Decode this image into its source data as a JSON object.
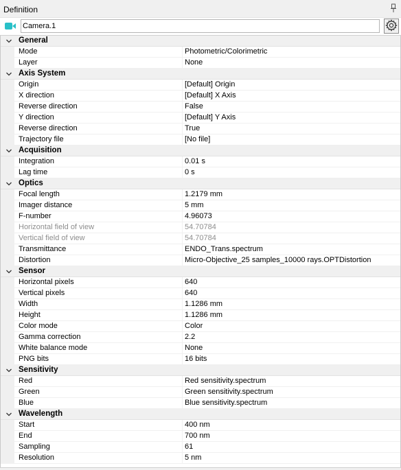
{
  "panel": {
    "title": "Definition",
    "pin_icon": "pin-icon"
  },
  "object": {
    "name": "Camera.1",
    "icon": "camera-icon",
    "icon_color": "#29c0c8",
    "settings_icon": "gear-icon"
  },
  "categories": [
    {
      "name": "General",
      "props": [
        {
          "name": "Mode",
          "value": "Photometric/Colorimetric"
        },
        {
          "name": "Layer",
          "value": "None"
        }
      ]
    },
    {
      "name": "Axis System",
      "props": [
        {
          "name": "Origin",
          "value": "[Default] Origin"
        },
        {
          "name": "X direction",
          "value": "[Default] X Axis"
        },
        {
          "name": "Reverse direction",
          "value": "False"
        },
        {
          "name": "Y direction",
          "value": "[Default] Y Axis"
        },
        {
          "name": "Reverse direction",
          "value": "True"
        },
        {
          "name": "Trajectory file",
          "value": "[No file]"
        }
      ]
    },
    {
      "name": "Acquisition",
      "props": [
        {
          "name": "Integration",
          "value": "0.01 s"
        },
        {
          "name": "Lag time",
          "value": "0 s"
        }
      ]
    },
    {
      "name": "Optics",
      "props": [
        {
          "name": "Focal length",
          "value": "1.2179 mm"
        },
        {
          "name": "Imager distance",
          "value": "5 mm"
        },
        {
          "name": "F-number",
          "value": "4.96073"
        },
        {
          "name": "Horizontal field of view",
          "value": "54.70784",
          "disabled": true
        },
        {
          "name": "Vertical field of view",
          "value": "54.70784",
          "disabled": true
        },
        {
          "name": "Transmittance",
          "value": "ENDO_Trans.spectrum"
        },
        {
          "name": "Distortion",
          "value": "Micro-Objective_25 samples_10000 rays.OPTDistortion"
        }
      ]
    },
    {
      "name": "Sensor",
      "props": [
        {
          "name": "Horizontal pixels",
          "value": "640"
        },
        {
          "name": "Vertical pixels",
          "value": "640"
        },
        {
          "name": "Width",
          "value": "1.1286 mm"
        },
        {
          "name": "Height",
          "value": "1.1286 mm"
        },
        {
          "name": "Color mode",
          "value": "Color"
        },
        {
          "name": "Gamma correction",
          "value": "2.2"
        },
        {
          "name": "White balance mode",
          "value": "None"
        },
        {
          "name": "PNG bits",
          "value": "16 bits"
        }
      ]
    },
    {
      "name": "Sensitivity",
      "props": [
        {
          "name": "Red",
          "value": "Red sensitivity.spectrum"
        },
        {
          "name": "Green",
          "value": "Green sensitivity.spectrum"
        },
        {
          "name": "Blue",
          "value": "Blue sensitivity.spectrum"
        }
      ]
    },
    {
      "name": "Wavelength",
      "props": [
        {
          "name": "Start",
          "value": "400 nm"
        },
        {
          "name": "End",
          "value": "700 nm"
        },
        {
          "name": "Sampling",
          "value": "61"
        },
        {
          "name": "Resolution",
          "value": "5 nm"
        }
      ]
    }
  ]
}
